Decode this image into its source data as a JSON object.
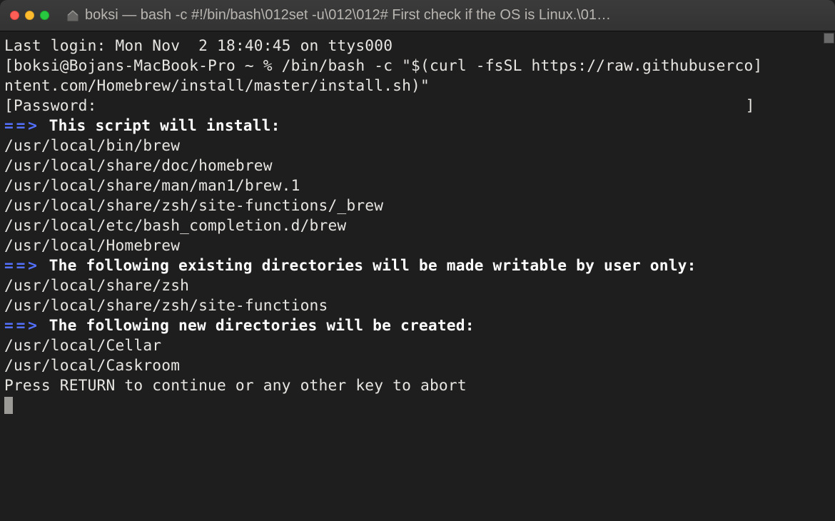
{
  "titlebar": {
    "icon": "home-icon",
    "title": "boksi — bash -c #!/bin/bash\\012set -u\\012\\012# First check if the OS is Linux.\\01…"
  },
  "terminal": {
    "last_login": "Last login: Mon Nov  2 18:40:45 on ttys000",
    "prompt_line1": "[boksi@Bojans-MacBook-Pro ~ % /bin/bash -c \"$(curl -fsSL https://raw.githubuserco]",
    "prompt_line2": "ntent.com/Homebrew/install/master/install.sh)\"",
    "password_line_open": "[",
    "password_label": "Password:",
    "password_line_close": "]",
    "arrow": "==>",
    "install_header": " This script will install:",
    "install_paths": [
      "/usr/local/bin/brew",
      "/usr/local/share/doc/homebrew",
      "/usr/local/share/man/man1/brew.1",
      "/usr/local/share/zsh/site-functions/_brew",
      "/usr/local/etc/bash_completion.d/brew",
      "/usr/local/Homebrew"
    ],
    "writable_header": " The following existing directories will be made writable by user only:",
    "writable_paths": [
      "/usr/local/share/zsh",
      "/usr/local/share/zsh/site-functions"
    ],
    "newdir_header": " The following new directories will be created:",
    "newdir_paths": [
      "/usr/local/Cellar",
      "/usr/local/Caskroom"
    ],
    "blank": "",
    "continue_prompt": "Press RETURN to continue or any other key to abort"
  }
}
